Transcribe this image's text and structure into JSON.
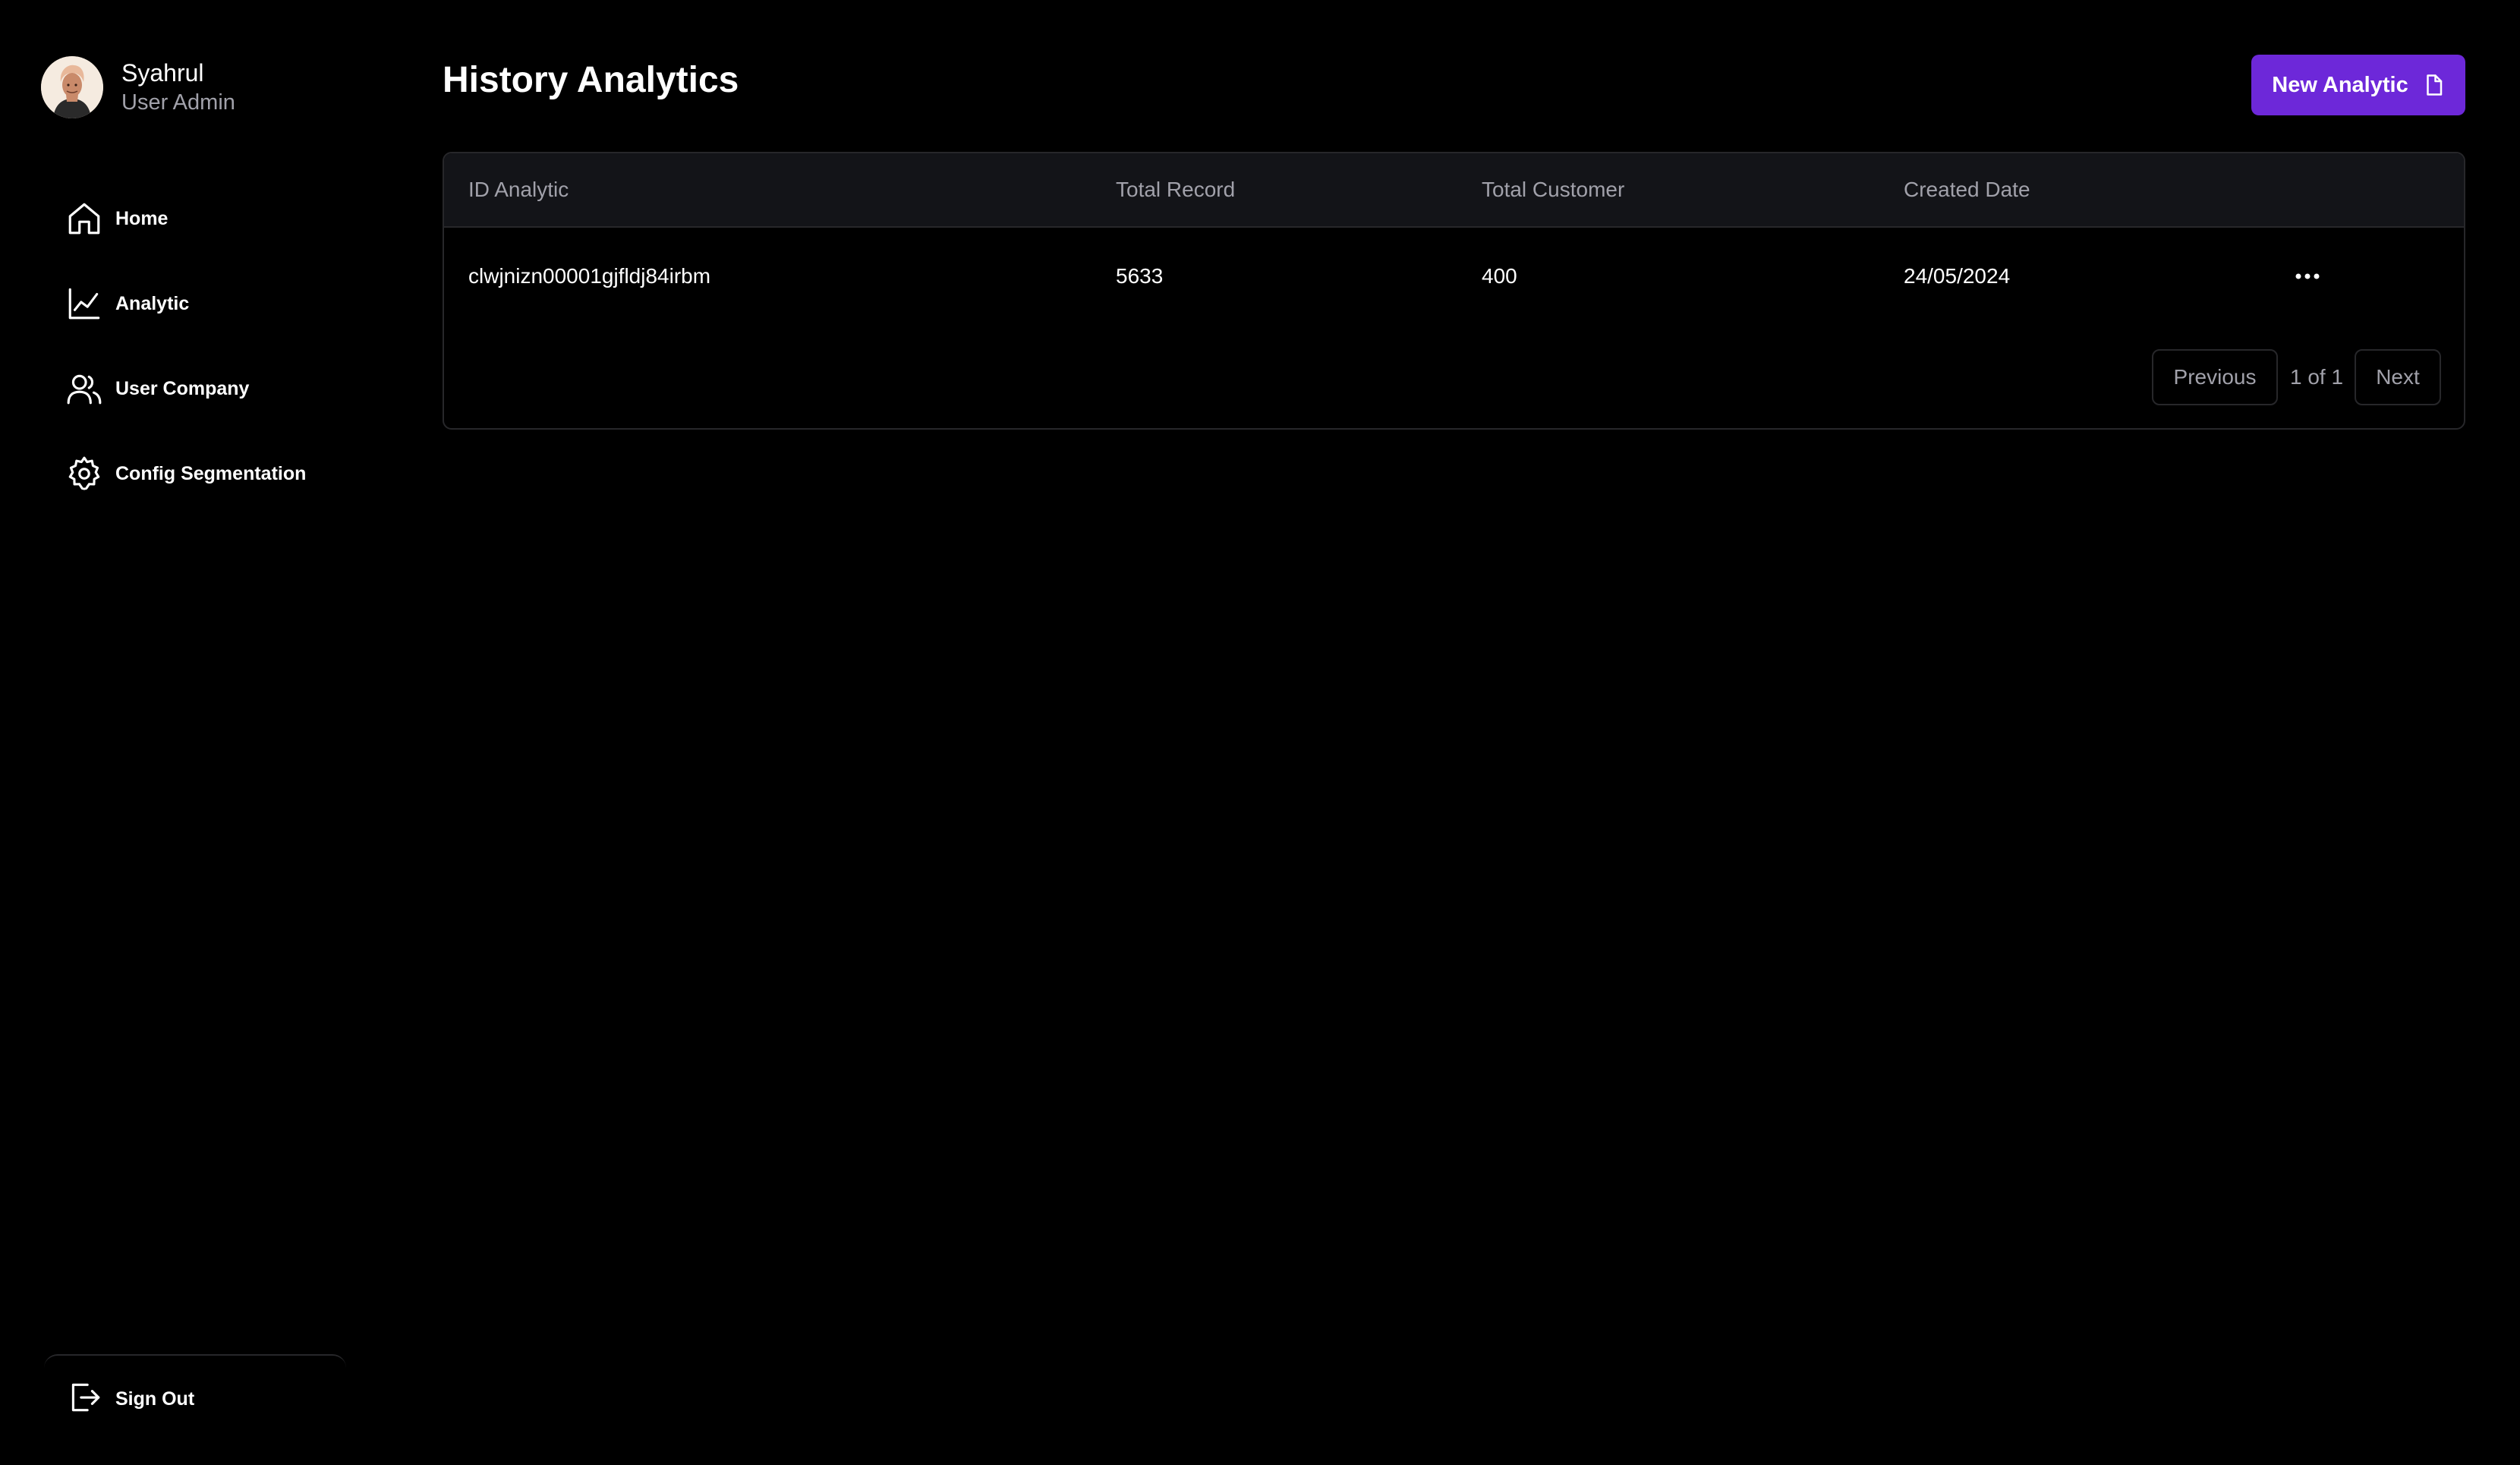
{
  "sidebar": {
    "profile": {
      "name": "Syahrul",
      "role": "User Admin"
    },
    "items": [
      {
        "label": "Home",
        "icon": "home-icon"
      },
      {
        "label": "Analytic",
        "icon": "chart-line-icon"
      },
      {
        "label": "User Company",
        "icon": "users-icon"
      },
      {
        "label": "Config Segmentation",
        "icon": "gear-icon"
      }
    ],
    "signout_label": "Sign Out",
    "signout_icon": "sign-out-icon"
  },
  "main": {
    "title": "History Analytics",
    "new_button_label": "New Analytic",
    "new_button_icon": "file-icon",
    "table": {
      "columns": [
        "ID Analytic",
        "Total Record",
        "Total Customer",
        "Created Date"
      ],
      "rows": [
        {
          "id": "clwjnizn00001gjfldj84irbm",
          "total_record": "5633",
          "total_customer": "400",
          "created_date": "24/05/2024"
        }
      ]
    },
    "pagination": {
      "previous_label": "Previous",
      "page_info": "1 of 1",
      "next_label": "Next"
    }
  },
  "colors": {
    "background": "#000000",
    "accent": "#6d28d9",
    "muted_text": "#a1a1aa",
    "border": "#27272a"
  }
}
